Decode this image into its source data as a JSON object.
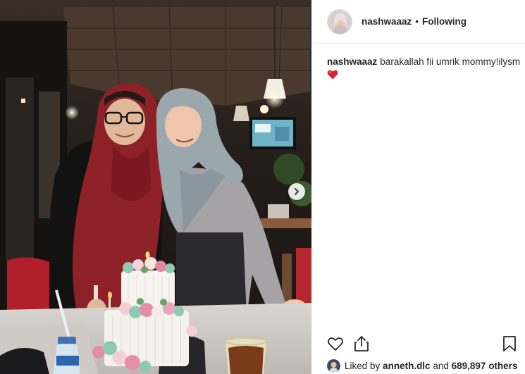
{
  "post": {
    "author": {
      "username": "nashwaaaz",
      "separator": "•",
      "follow_status": "Following",
      "avatar_icon": "profile-avatar"
    },
    "caption": {
      "username": "nashwaaaz",
      "text": "barakallah fii umrik mommy!ilysm",
      "emoji": "red-heart-icon"
    },
    "photo": {
      "description_icon": "photo-two-women-with-birthday-cake",
      "next_icon": "chevron-right-icon"
    },
    "actions": {
      "like_icon": "heart-outline-icon",
      "share_icon": "share-icon",
      "save_icon": "bookmark-icon"
    },
    "likes": {
      "prefix": "Liked by",
      "user": "anneth.dlc",
      "middle": "and",
      "count": "689,897 others"
    }
  },
  "colors": {
    "text": "#262626",
    "border": "#efefef",
    "heart_red": "#ed4956",
    "scarf_red": "#8e2127",
    "hijab_grey": "#9aa7ad"
  }
}
